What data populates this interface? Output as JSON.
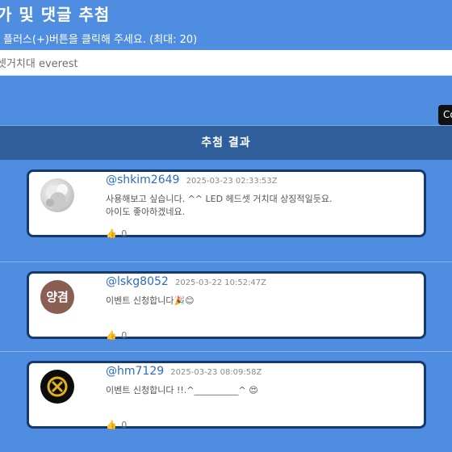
{
  "header": {
    "title": "가 및 댓글 추첨",
    "subtitle": "플러스(+)버튼을 클릭해 주세요. (최대: 20)"
  },
  "search": {
    "value": "셋거치대 everest",
    "placeholder": ""
  },
  "copy_button": {
    "label": "Co"
  },
  "results": {
    "title": "추첨 결과",
    "comments": [
      {
        "username": "@shkim2649",
        "timestamp": "2025-03-23 02:33:53Z",
        "lines": [
          "사용해보고 싶습니다. ^^ LED 헤드셋 거치대 상징적일듯요.",
          "아이도 좋아하겠네요."
        ],
        "avatar": "photo-avatar",
        "likes": "0"
      },
      {
        "username": "@lskg8052",
        "timestamp": "2025-03-22 10:52:47Z",
        "lines": [
          "이벤트 신청합니다🎉😊"
        ],
        "avatar_text": "양겸",
        "avatar_color": "#8b5e54",
        "likes": "0"
      },
      {
        "username": "@hm7129",
        "timestamp": "2025-03-23 08:09:58Z",
        "lines": [
          "이벤트 신청합니다 !!.^__________^ 😍"
        ],
        "avatar": "x-emblem-avatar",
        "likes": "0"
      }
    ]
  },
  "colors": {
    "page_bg": "#4f8de0",
    "header_bar": "#2f5f9a",
    "card_border": "#163a6e",
    "username": "#2d6bc2"
  },
  "icons": {
    "like": "thumbs-up-icon"
  }
}
